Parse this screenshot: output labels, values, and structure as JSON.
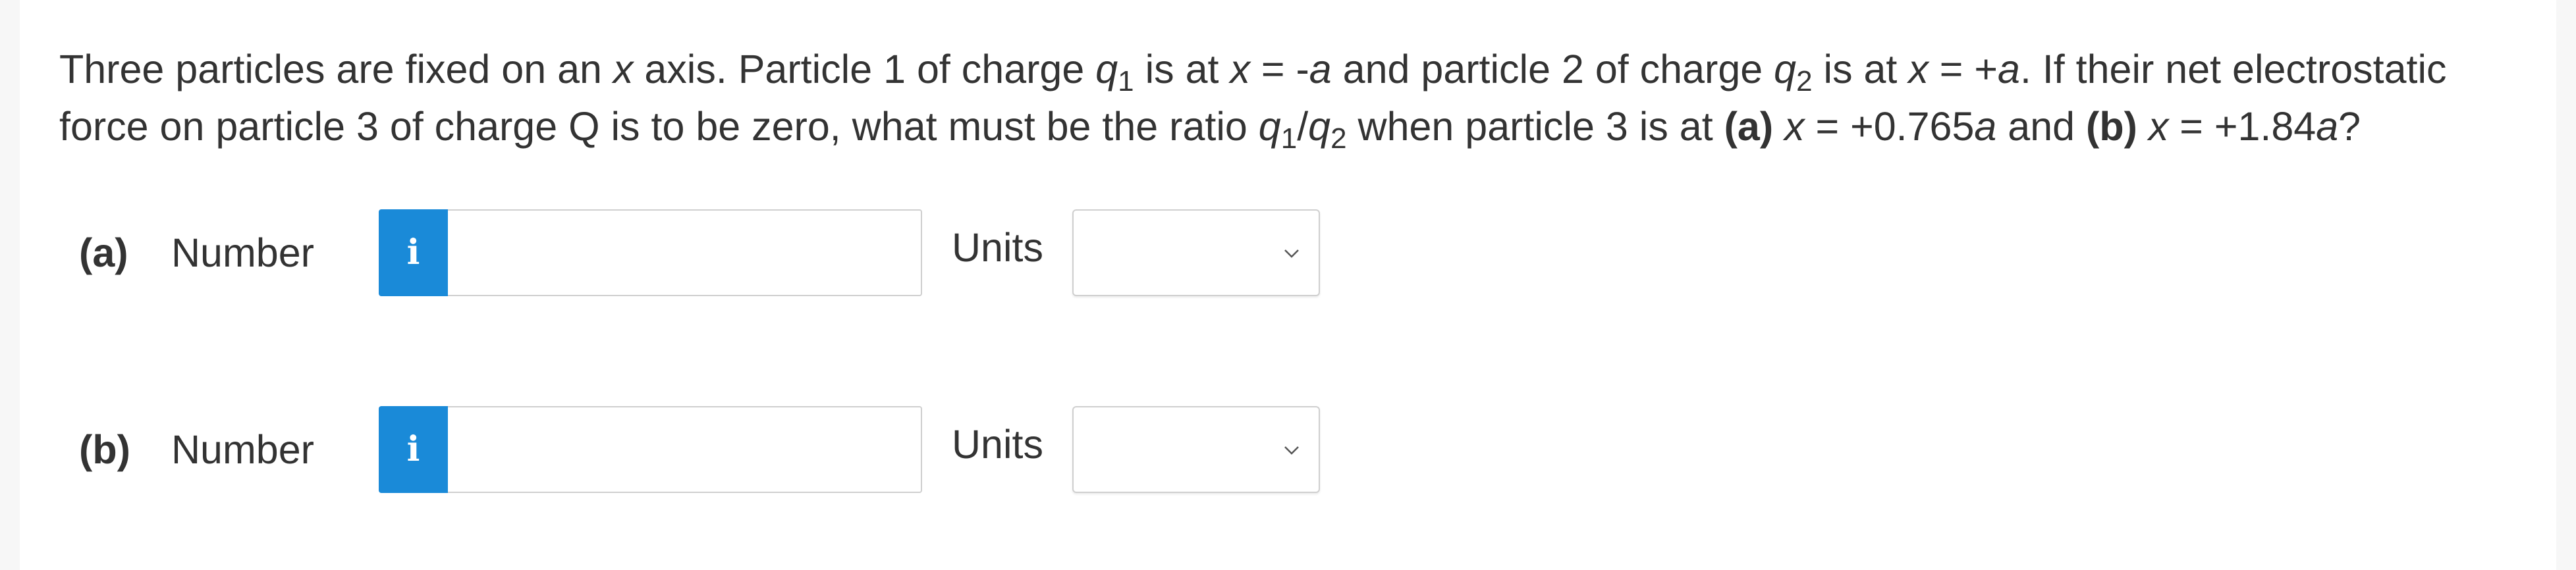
{
  "question": {
    "segments": [
      {
        "t": "Three particles are fixed on an "
      },
      {
        "t": "x",
        "i": true
      },
      {
        "t": " axis. Particle 1 of charge "
      },
      {
        "t": "q",
        "i": true
      },
      {
        "t": "1",
        "sub": true
      },
      {
        "t": " is at "
      },
      {
        "t": "x",
        "i": true
      },
      {
        "t": " = -"
      },
      {
        "t": "a",
        "i": true
      },
      {
        "t": " and particle 2 of charge "
      },
      {
        "t": "q",
        "i": true
      },
      {
        "t": "2",
        "sub": true
      },
      {
        "t": " is at "
      },
      {
        "t": "x",
        "i": true
      },
      {
        "t": " = +"
      },
      {
        "t": "a",
        "i": true
      },
      {
        "t": ". If their net electrostatic force on particle 3 of charge Q is to be zero, what must be the ratio "
      },
      {
        "t": "q",
        "i": true
      },
      {
        "t": "1",
        "sub": true
      },
      {
        "t": "/"
      },
      {
        "t": "q",
        "i": true
      },
      {
        "t": "2",
        "sub": true
      },
      {
        "t": " when particle 3 is at "
      },
      {
        "t": "(a)",
        "b": true
      },
      {
        "t": " "
      },
      {
        "t": "x",
        "i": true
      },
      {
        "t": " = +0.765"
      },
      {
        "t": "a",
        "i": true
      },
      {
        "t": " and "
      },
      {
        "t": "(b)",
        "b": true
      },
      {
        "t": " "
      },
      {
        "t": "x",
        "i": true
      },
      {
        "t": " = +1.84"
      },
      {
        "t": "a",
        "i": true
      },
      {
        "t": "?"
      }
    ]
  },
  "parts": {
    "a": {
      "label": "(a)",
      "number_label": "Number",
      "info_glyph": "i",
      "number_value": "",
      "units_label": "Units",
      "units_selected": ""
    },
    "b": {
      "label": "(b)",
      "number_label": "Number",
      "info_glyph": "i",
      "number_value": "",
      "units_label": "Units",
      "units_selected": ""
    }
  },
  "colors": {
    "info_button": "#1a8ad8",
    "text": "#333333",
    "input_border": "#cfcfcf"
  },
  "icons": {
    "info": "info-icon",
    "dropdown": "chevron-down-icon"
  }
}
